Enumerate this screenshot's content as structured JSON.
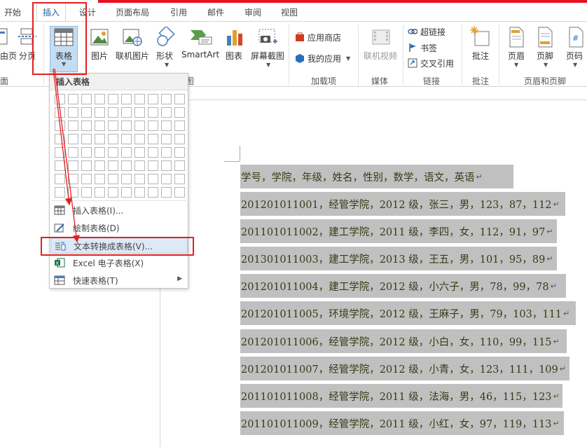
{
  "tabs": [
    {
      "label": "开始"
    },
    {
      "label": "插入"
    },
    {
      "label": "设计"
    },
    {
      "label": "页面布局"
    },
    {
      "label": "引用"
    },
    {
      "label": "邮件"
    },
    {
      "label": "审阅"
    },
    {
      "label": "视图"
    }
  ],
  "ribbon": {
    "pages_group": {
      "cover_label": "由页",
      "break_label": "分页",
      "group_label": "面"
    },
    "table_button": {
      "label": "表格"
    },
    "illustrations": {
      "picture": "图片",
      "online_picture": "联机图片",
      "shapes": "形状",
      "smartart": "SmartArt",
      "chart": "图表",
      "screenshot": "屏幕截图",
      "group_label": "图"
    },
    "addins": {
      "store": "应用商店",
      "my_apps": "我的应用",
      "group_label": "加载项"
    },
    "media": {
      "online_video": "联机视频",
      "group_label": "媒体"
    },
    "links": {
      "hyperlink": "超链接",
      "bookmark": "书签",
      "cross_ref": "交叉引用",
      "group_label": "链接"
    },
    "comments": {
      "comment": "批注",
      "group_label": "批注"
    },
    "header_footer": {
      "header": "页眉",
      "footer": "页脚",
      "page_number": "页码",
      "group_label": "页眉和页脚"
    }
  },
  "dropdown": {
    "header": "插入表格",
    "grid": {
      "cols": 10,
      "rows": 8
    },
    "items": [
      {
        "label": "插入表格(I)...",
        "icon": "insert-table-icon"
      },
      {
        "label": "绘制表格(D)",
        "icon": "draw-table-icon"
      },
      {
        "label": "文本转换成表格(V)...",
        "icon": "text-to-table-icon"
      },
      {
        "label": "Excel 电子表格(X)",
        "icon": "excel-icon"
      },
      {
        "label": "快速表格(T)",
        "icon": "quick-table-icon"
      }
    ]
  },
  "document": {
    "paragraph_mark": "↵",
    "lines": [
      "学号，学院，年级，姓名，性别，数学，语文，英语",
      "201201011001，经管学院，2012 级，张三，男，123，87，112",
      "201101011002，建工学院，2011 级，李四，女，112，91，97",
      "201301011003，建工学院，2013 级，王五，男，101，95，89",
      "201201011004，建工学院，2012 级，小六子，男，78，99，78",
      "201201011005，环境学院，2012 级，王麻子，男，79，103，111",
      "201201011006，经管学院，2012 级，小白，女，110，99，115",
      "201201011007，经管学院，2012 级，小青，女，123，111，109",
      "201101011008，经管学院，2011 级，法海，男，46，115，123",
      "201101011009，经管学院，2011 级，小红，女，97，119，113"
    ]
  },
  "colors": {
    "accent": "#2b579a",
    "annotation_red": "#e02020",
    "selection_gray": "#c0c0c0",
    "highlight_blue": "#dce9f7"
  }
}
